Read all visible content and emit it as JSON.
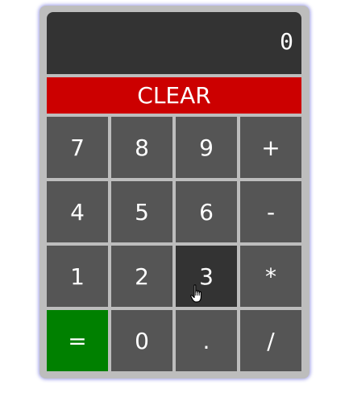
{
  "display": {
    "value": "0"
  },
  "clear_label": "CLEAR",
  "keys": [
    {
      "label": "7",
      "name": "key-7"
    },
    {
      "label": "8",
      "name": "key-8"
    },
    {
      "label": "9",
      "name": "key-9"
    },
    {
      "label": "+",
      "name": "key-plus"
    },
    {
      "label": "4",
      "name": "key-4"
    },
    {
      "label": "5",
      "name": "key-5"
    },
    {
      "label": "6",
      "name": "key-6"
    },
    {
      "label": "-",
      "name": "key-minus"
    },
    {
      "label": "1",
      "name": "key-1"
    },
    {
      "label": "2",
      "name": "key-2"
    },
    {
      "label": "3",
      "name": "key-3"
    },
    {
      "label": "*",
      "name": "key-multiply"
    },
    {
      "label": "=",
      "name": "key-equals"
    },
    {
      "label": "0",
      "name": "key-0"
    },
    {
      "label": ".",
      "name": "key-decimal"
    },
    {
      "label": "/",
      "name": "key-divide"
    }
  ],
  "colors": {
    "display_bg": "#333333",
    "clear_bg": "#cc0000",
    "key_bg": "#555555",
    "equals_bg": "#008000",
    "hover_bg": "#333333"
  },
  "hovered_key": "3",
  "cursor_icon": "hand-pointer-icon"
}
